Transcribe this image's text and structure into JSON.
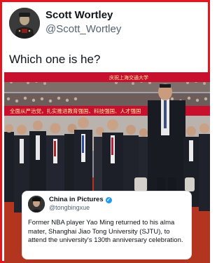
{
  "tweet": {
    "author_name": "Scott Wortley",
    "author_handle": "@Scott_Wortley",
    "text": "Which one is he?"
  },
  "photo": {
    "banner_text_1": "庆祝上海交通大学",
    "banner_text_2": "全面从严治党，扎实推进教育强国、科技强国、人才强国"
  },
  "quoted_post": {
    "author_name": "China in Pictures",
    "author_handle": "@tongbingxue",
    "text": "Former NBA player Yao Ming returned to his alma mater, Shanghai Jiao Tong University (SJTU), to attend the university's 130th anniversary celebration."
  },
  "colors": {
    "frame_border": "#e8141b",
    "banner_red": "#c8102e",
    "verified_blue": "#1d9bf0"
  }
}
